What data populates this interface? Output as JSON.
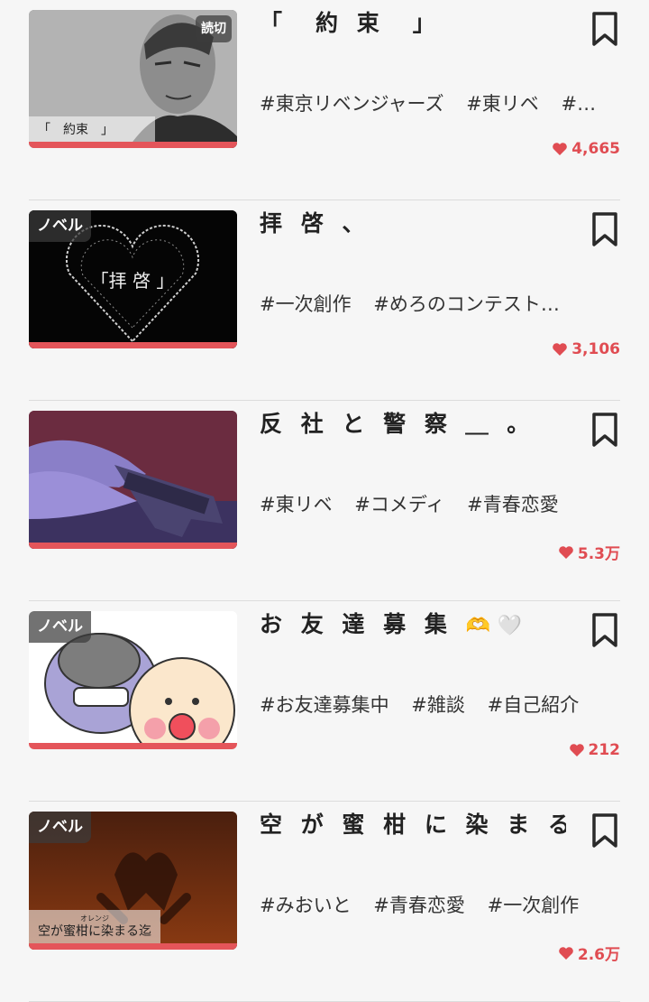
{
  "items": [
    {
      "title": "「　約 束　」",
      "badge_left": "",
      "badge_right": "読切",
      "caption": "「　約束　」",
      "caption_ruby": "",
      "tags": [
        "#東京リベンジャーズ",
        "#東リベ",
        "#…"
      ],
      "likes": "4,665"
    },
    {
      "title": "拝 啓 、",
      "badge_left": "ノベル",
      "badge_right": "",
      "caption": "",
      "caption_ruby": "",
      "tags": [
        "#一次創作",
        "#めろのコンテスト…"
      ],
      "likes": "3,106"
    },
    {
      "title": "反 社 と 警 察 ＿ 。",
      "badge_left": "",
      "badge_right": "",
      "caption": "",
      "caption_ruby": "",
      "tags": [
        "#東リベ",
        "#コメディ",
        "#青春恋愛"
      ],
      "likes": "5.3万"
    },
    {
      "title": "お 友 達 募 集",
      "title_emoji": "🫶 🤍",
      "badge_left": "ノベル",
      "badge_right": "",
      "caption": "",
      "caption_ruby": "",
      "tags": [
        "#お友達募集中",
        "#雑談",
        "#自己紹介"
      ],
      "likes": "212"
    },
    {
      "title": "空 が 蜜 柑 に 染 ま る 迄",
      "badge_left": "ノベル",
      "badge_right": "",
      "caption": "空が蜜柑に染まる迄",
      "caption_ruby": "オレンジ",
      "tags": [
        "#みおいと",
        "#青春恋愛",
        "#一次創作"
      ],
      "likes": "2.6万"
    }
  ],
  "colors": {
    "accent": "#e4555a",
    "like": "#e04c52",
    "background": "#f6f6f6"
  },
  "icons": {
    "bookmark": "bookmark-icon",
    "like": "heart-icon"
  }
}
